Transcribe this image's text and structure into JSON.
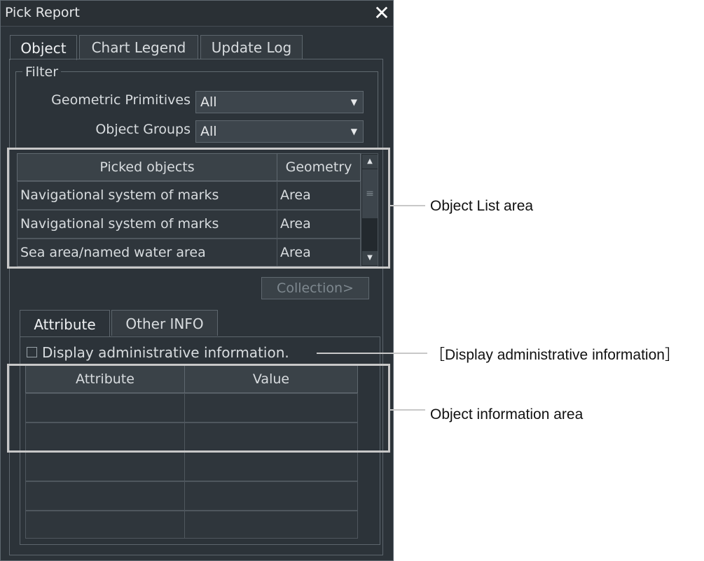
{
  "window": {
    "title": "Pick Report"
  },
  "tabs": [
    {
      "label": "Object"
    },
    {
      "label": "Chart Legend"
    },
    {
      "label": "Update Log"
    }
  ],
  "filter": {
    "legend": "Filter",
    "geometric_primitives_label": "Geometric Primitives",
    "geometric_primitives_value": "All",
    "object_groups_label": "Object Groups",
    "object_groups_value": "All"
  },
  "object_list": {
    "columns": [
      "Picked objects",
      "Geometry"
    ],
    "rows": [
      [
        "Navigational system of marks",
        "Area"
      ],
      [
        "Navigational system of marks",
        "Area"
      ],
      [
        "Sea area/named water area",
        "Area"
      ]
    ]
  },
  "collection_button": "Collection>",
  "sub_tabs": [
    {
      "label": "Attribute"
    },
    {
      "label": "Other INFO"
    }
  ],
  "display_admin_label": "Display administrative information.",
  "attribute_table": {
    "columns": [
      "Attribute",
      "Value"
    ]
  },
  "annotations": {
    "object_list_area": "Object List area",
    "display_admin": "［Display administrative information］",
    "object_info_area": "Object information area",
    "color": "#c8c8c8"
  },
  "colors": {
    "window_bg": "#2c3339",
    "text": "#d8dcdf",
    "disabled_text": "#7e888f"
  }
}
